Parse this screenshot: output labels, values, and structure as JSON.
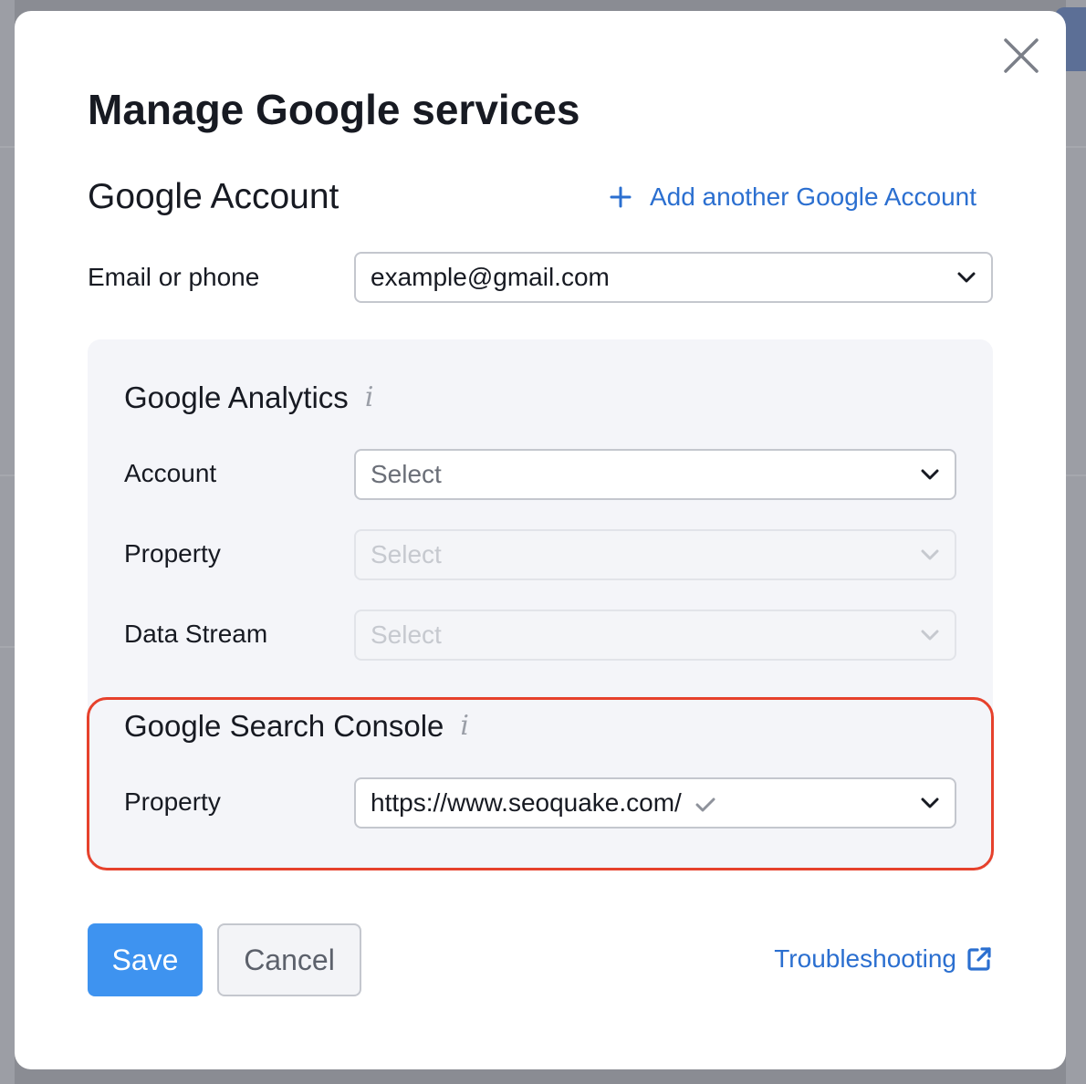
{
  "modal": {
    "title": "Manage Google services",
    "google_account": {
      "section_title": "Google Account",
      "add_link_label": "Add another Google Account",
      "email_label": "Email or phone",
      "email_value": "example@gmail.com"
    },
    "google_analytics": {
      "title": "Google Analytics",
      "account_label": "Account",
      "account_placeholder": "Select",
      "property_label": "Property",
      "property_placeholder": "Select",
      "data_stream_label": "Data Stream",
      "data_stream_placeholder": "Select"
    },
    "google_search_console": {
      "title": "Google Search Console",
      "property_label": "Property",
      "property_value": "https://www.seoquake.com/"
    },
    "footer": {
      "save_label": "Save",
      "cancel_label": "Cancel",
      "troubleshooting_label": "Troubleshooting"
    }
  },
  "colors": {
    "link": "#2b6fd0",
    "primary_button": "#3e93f0",
    "highlight_border": "#e6412c",
    "panel_background": "#f4f5f9"
  },
  "icons": [
    "close-icon",
    "plus-icon",
    "chevron-down-icon",
    "info-icon",
    "check-icon",
    "external-link-icon"
  ]
}
